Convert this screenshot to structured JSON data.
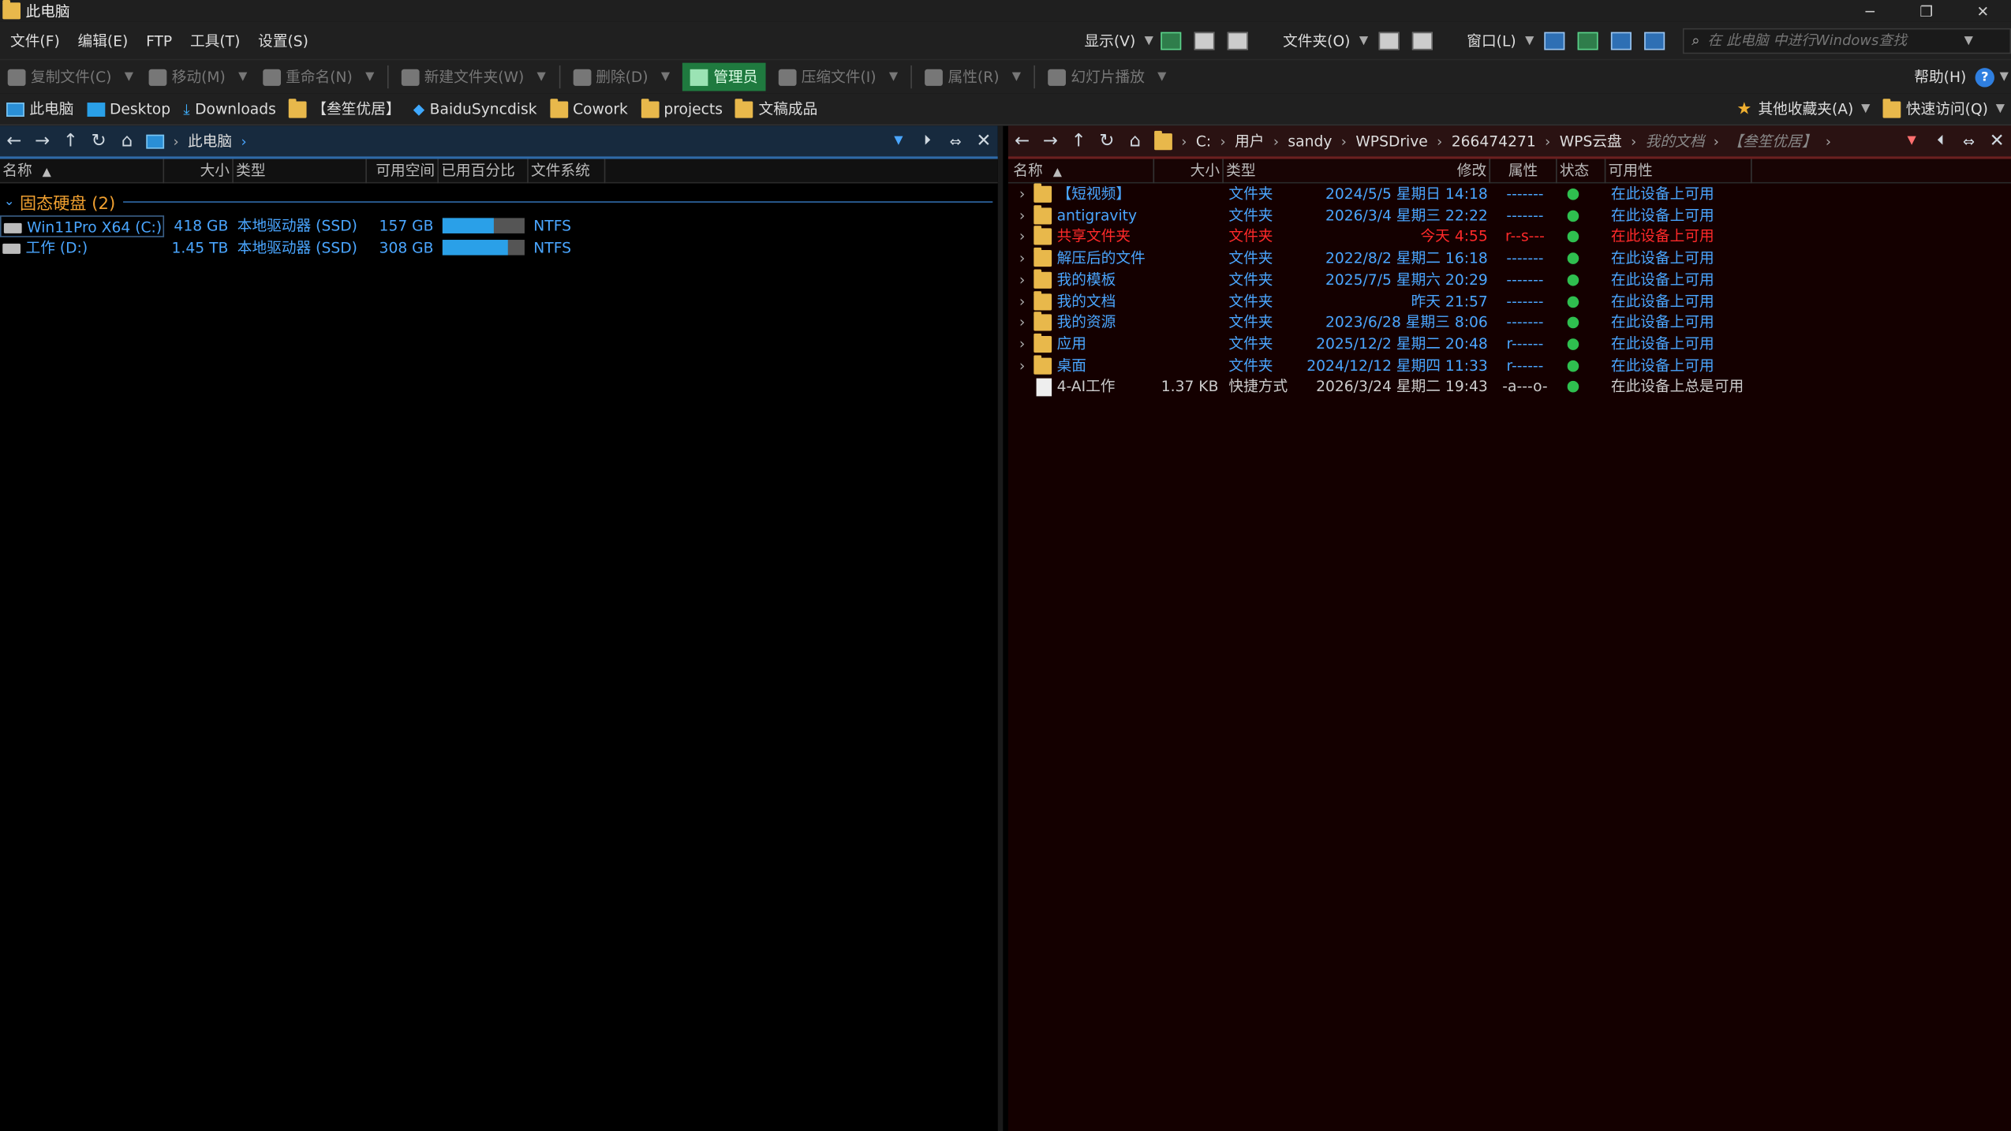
{
  "window": {
    "title": "此电脑",
    "ctrl_min": "─",
    "ctrl_restore": "❐",
    "ctrl_close": "✕"
  },
  "menu": {
    "items": [
      "文件(F)",
      "编辑(E)",
      "FTP",
      "工具(T)",
      "设置(S)"
    ],
    "display": "显示(V)",
    "folder": "文件夹(O)",
    "window": "窗口(L)",
    "search_placeholder": "在 此电脑 中进行Windows查找",
    "help": "帮助(H)"
  },
  "toolbar": {
    "copy": "复制文件(C)",
    "move": "移动(M)",
    "rename": "重命名(N)",
    "newfolder": "新建文件夹(W)",
    "delete": "删除(D)",
    "admin": "管理员",
    "compress": "压缩文件(I)",
    "props": "属性(R)",
    "slideshow": "幻灯片播放"
  },
  "favbar": {
    "items": [
      "此电脑",
      "Desktop",
      "Downloads",
      "【叁笙优居】",
      "BaiduSyncdisk",
      "Cowork",
      "projects",
      "文稿成品"
    ],
    "other": "其他收藏夹(A)",
    "quick": "快速访问(Q)"
  },
  "left": {
    "path": [
      "此电脑"
    ],
    "headers": [
      "名称",
      "大小",
      "类型",
      "可用空间",
      "已用百分比",
      "文件系统"
    ],
    "group": "固态硬盘 (2)",
    "drives": [
      {
        "name": "Win11Pro X64 (C:)",
        "size": "418 GB",
        "type": "本地驱动器 (SSD)",
        "free": "157 GB",
        "used_pct": 62,
        "fs": "NTFS"
      },
      {
        "name": "工作 (D:)",
        "size": "1.45 TB",
        "type": "本地驱动器 (SSD)",
        "free": "308 GB",
        "used_pct": 79,
        "fs": "NTFS"
      }
    ]
  },
  "right": {
    "path": [
      "C:",
      "用户",
      "sandy",
      "WPSDrive",
      "266474271",
      "WPS云盘",
      "我的文档",
      "【叁笙优居】"
    ],
    "headers": [
      "名称",
      "大小",
      "类型",
      "修改",
      "属性",
      "状态",
      "可用性"
    ],
    "rows": [
      {
        "name": "【短视频】",
        "size": "",
        "type": "文件夹",
        "modified": "2024/5/5 星期日 14:18",
        "attr": "-------",
        "avail": "在此设备上可用",
        "hl": false,
        "folder": true
      },
      {
        "name": "antigravity",
        "size": "",
        "type": "文件夹",
        "modified": "2026/3/4 星期三 22:22",
        "attr": "-------",
        "avail": "在此设备上可用",
        "hl": false,
        "folder": true
      },
      {
        "name": "共享文件夹",
        "size": "",
        "type": "文件夹",
        "modified": "今天   4:55",
        "attr": "r--s---",
        "avail": "在此设备上可用",
        "hl": true,
        "folder": true
      },
      {
        "name": "解压后的文件",
        "size": "",
        "type": "文件夹",
        "modified": "2022/8/2 星期二 16:18",
        "attr": "-------",
        "avail": "在此设备上可用",
        "hl": false,
        "folder": true
      },
      {
        "name": "我的模板",
        "size": "",
        "type": "文件夹",
        "modified": "2025/7/5 星期六 20:29",
        "attr": "-------",
        "avail": "在此设备上可用",
        "hl": false,
        "folder": true
      },
      {
        "name": "我的文档",
        "size": "",
        "type": "文件夹",
        "modified": "昨天  21:57",
        "attr": "-------",
        "avail": "在此设备上可用",
        "hl": false,
        "folder": true
      },
      {
        "name": "我的资源",
        "size": "",
        "type": "文件夹",
        "modified": "2023/6/28 星期三  8:06",
        "attr": "-------",
        "avail": "在此设备上可用",
        "hl": false,
        "folder": true
      },
      {
        "name": "应用",
        "size": "",
        "type": "文件夹",
        "modified": "2025/12/2 星期二 20:48",
        "attr": "r------",
        "avail": "在此设备上可用",
        "hl": false,
        "folder": true
      },
      {
        "name": "桌面",
        "size": "",
        "type": "文件夹",
        "modified": "2024/12/12 星期四 11:33",
        "attr": "r------",
        "avail": "在此设备上可用",
        "hl": false,
        "folder": true
      },
      {
        "name": "4-AI工作",
        "size": "1.37 KB",
        "type": "快捷方式",
        "modified": "2026/3/24 星期二 19:43",
        "attr": "-a---o-",
        "avail": "在此设备上总是可用",
        "hl": false,
        "folder": false
      }
    ]
  },
  "colors": {
    "link_blue": "#4aa6ff",
    "highlight_red": "#ff2a2a",
    "group_orange": "#f0a030",
    "ok_green": "#2fbf4f",
    "gray_text": "#cccccc"
  }
}
